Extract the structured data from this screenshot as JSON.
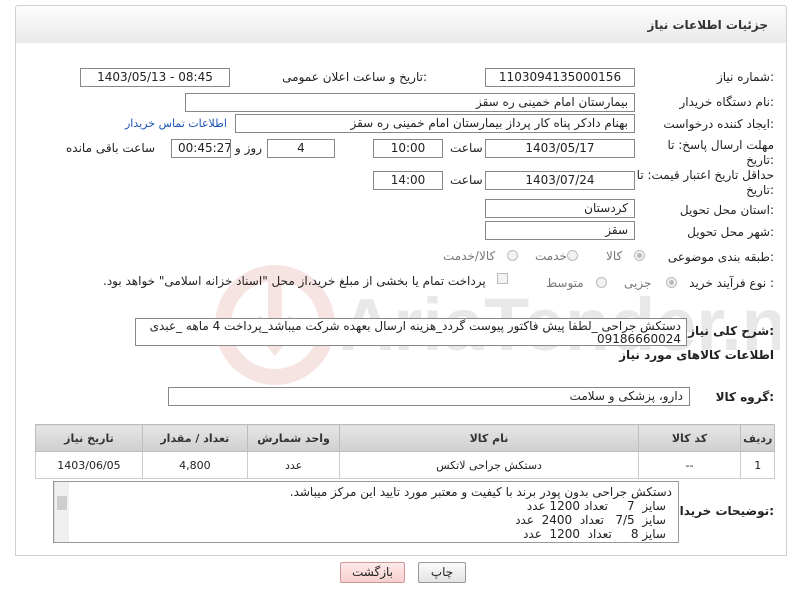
{
  "page_title": "جزئیات اطلاعات نیاز",
  "need_number": {
    "label": "شماره نیاز:",
    "value": "1103094135000156"
  },
  "announce_datetime": {
    "label": "تاریخ و ساعت اعلان عمومی:",
    "value": "1403/05/13 - 08:45"
  },
  "buyer_org": {
    "label": "نام دستگاه خریدار:",
    "value": "بیمارستان امام خمینی  ره  سقز"
  },
  "requester": {
    "label": "ایجاد کننده درخواست:",
    "value": "بهنام دادکر پناه کار پرداز بیمارستان امام خمینی  ره  سقز",
    "contact_link": "اطلاعات تماس خریدار"
  },
  "reply_deadline": {
    "label": "مهلت ارسال پاسخ: تا تاریخ:",
    "date": "1403/05/17",
    "time_label": "ساعت",
    "time": "10:00",
    "days": "4",
    "days_label": "روز و",
    "remaining": "00:45:27",
    "remaining_label": "ساعت باقی مانده"
  },
  "price_validity": {
    "label": "حداقل تاریخ اعتبار قیمت: تا تاریخ:",
    "date": "1403/07/24",
    "time_label": "ساعت",
    "time": "14:00"
  },
  "province": {
    "label": "استان محل تحویل:",
    "value": "کردستان"
  },
  "city": {
    "label": "شهر محل تحویل:",
    "value": "سقز"
  },
  "category": {
    "label": "طبقه بندی موضوعی:",
    "options": [
      "کالا",
      "خدمت",
      "کالا/خدمت"
    ]
  },
  "purchase_type": {
    "label": "نوع فرآیند خرید :",
    "options": [
      "جزیی",
      "متوسط"
    ],
    "note": "پرداخت تمام یا بخشی از مبلغ خرید،از محل \"اسناد خزانه اسلامی\" خواهد بود."
  },
  "description": {
    "label": "شرح کلی نیاز:",
    "line1": "دستکش جراحی _لطفا پیش فاکتور پیوست گردد_هزینه ارسال بعهده شرکت میباشد_پرداخت 4 ماهه _عبدی",
    "line2": "09186660024"
  },
  "goods_section_title": "اطلاعات کالاهای مورد نیاز",
  "goods_group": {
    "label": "گروه کالا:",
    "value": "دارو، پزشکی و سلامت"
  },
  "table": {
    "headers": [
      "ردیف",
      "کد کالا",
      "نام کالا",
      "واحد شمارش",
      "تعداد / مقدار",
      "تاریخ نیاز"
    ],
    "rows": [
      [
        "1",
        "--",
        "دستکش جراحی لاتکس",
        "عدد",
        "4,800",
        "1403/06/05"
      ]
    ]
  },
  "buyer_notes": {
    "label": "توضیحات خریدار:",
    "lines": [
      "دستکش جراحی بدون پودر برند  با کیفیت و معتبر مورد تایید این مرکز میباشد.",
      "سایز  7     تعداد 1200 عدد",
      "سایز  7/5   تعداد  2400  عدد",
      "سایز 8     تعداد  1200  عدد"
    ]
  },
  "buttons": {
    "print": "چاپ",
    "back": "بازگشت"
  },
  "watermark_text": "AriaTender.net"
}
